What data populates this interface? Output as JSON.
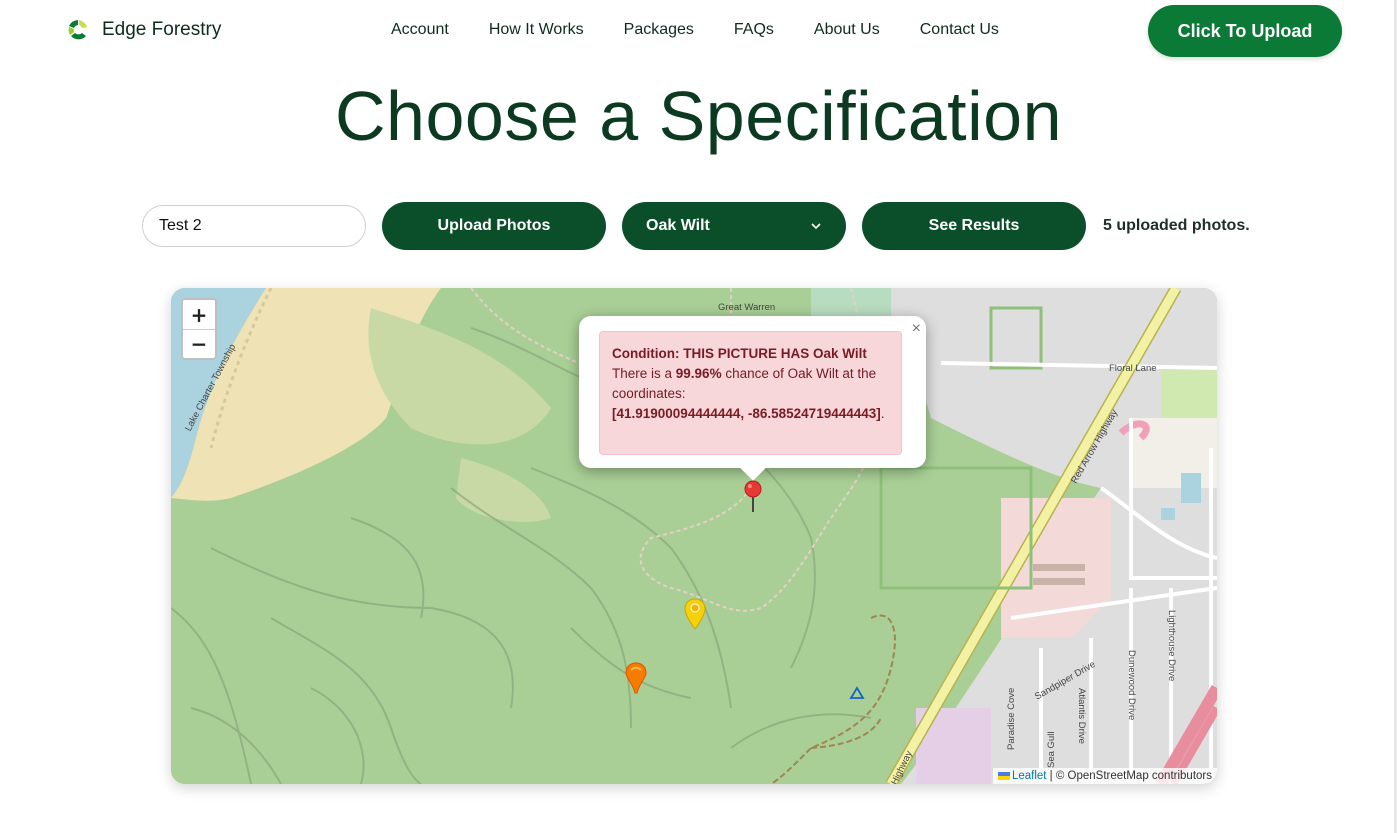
{
  "header": {
    "brand_name": "Edge Forestry",
    "nav": [
      "Account",
      "How It Works",
      "Packages",
      "FAQs",
      "About Us",
      "Contact Us"
    ],
    "cta_label": "Click To Upload"
  },
  "page_title": "Choose a Specification",
  "controls": {
    "name_input_value": "Test 2",
    "upload_label": "Upload Photos",
    "spec_selected": "Oak Wilt",
    "results_label": "See Results",
    "status": "5 uploaded photos."
  },
  "map": {
    "zoom_in": "+",
    "zoom_out": "−",
    "labels": {
      "great_warren": "Great Warren",
      "lake_charter": "Lake Charter Township",
      "floral_lane": "Floral Lane",
      "red_arrow": "Red Arrow Highway",
      "sandpiper": "Sandpiper Drive",
      "atlantis": "Atlantis Drive",
      "dunewood": "Dunewood Drive",
      "lighthouse": "Lighthouse Drive",
      "paradise": "Paradise Cove",
      "sea_gull": "Sea Gull",
      "highway": "Highway"
    },
    "popup": {
      "close": "×",
      "condition": "Condition: THIS PICTURE HAS Oak Wilt",
      "text_a": "There is a ",
      "percent": "99.96%",
      "text_b": " chance of Oak Wilt at the coordinates:",
      "coords": "[41.91900094444444, -86.58524719444443]",
      "end": "."
    },
    "attribution": {
      "leaflet": "Leaflet",
      "rest": " | © OpenStreetMap contributors"
    },
    "colors": {
      "forest": "#a9cf96",
      "sand": "#efe2b5",
      "water": "#aad3df",
      "urban": "#e0dfdf",
      "highway": "#f3f1a4"
    }
  }
}
